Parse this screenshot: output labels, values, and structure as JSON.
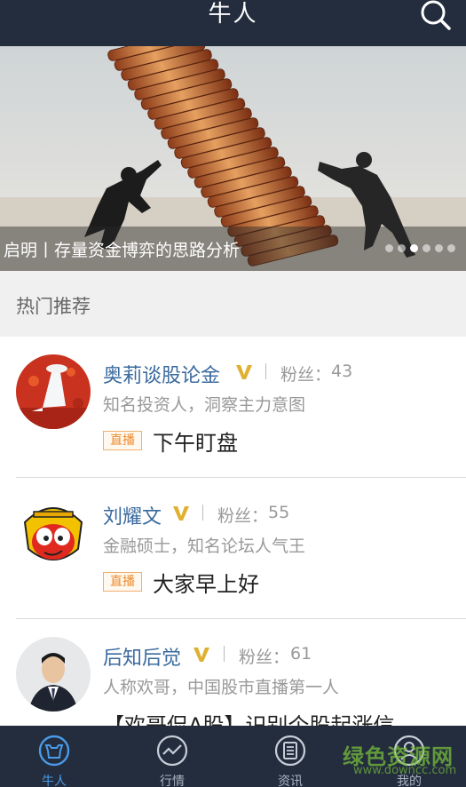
{
  "header": {
    "title": "牛人",
    "search_icon": "search-icon"
  },
  "banner": {
    "caption": "启明丨存量资金博弈的思路分析",
    "dots_total": 6,
    "dots_active_index": 2
  },
  "section": {
    "title": "热门推荐"
  },
  "feed": [
    {
      "name": "奥莉谈股论金",
      "verified": true,
      "fans_label": "粉丝：",
      "fans": "43",
      "desc": "知名投资人，洞察主力意图",
      "tag": "直播",
      "post": "下午盯盘",
      "avatar": "woman-in-red-field"
    },
    {
      "name": "刘耀文",
      "verified": true,
      "fans_label": "粉丝：",
      "fans": "55",
      "desc": "金融硕士，知名论坛人气王",
      "tag": "直播",
      "post": "大家早上好",
      "avatar": "monkey-king-cartoon"
    },
    {
      "name": "后知后觉",
      "verified": true,
      "fans_label": "粉丝：",
      "fans": "61",
      "desc": "人称欢哥，中国股市直播第一人",
      "tag": "",
      "post": "【欢哥侃A股】识别个股起涨信",
      "avatar": "man-in-suit"
    }
  ],
  "nav": [
    {
      "label": "牛人",
      "icon": "bull-icon",
      "active": true
    },
    {
      "label": "行情",
      "icon": "chart-line-icon",
      "active": false
    },
    {
      "label": "资讯",
      "icon": "news-list-icon",
      "active": false
    },
    {
      "label": "我的",
      "icon": "user-icon",
      "active": false
    }
  ],
  "watermark": {
    "line1": "绿色资源网",
    "line2": "www.downcc.com"
  },
  "colors": {
    "bar": "#232d3d",
    "accent": "#4a9be8",
    "name": "#3a6a9e",
    "verified": "#e0b030",
    "live": "#ee8a2a"
  }
}
